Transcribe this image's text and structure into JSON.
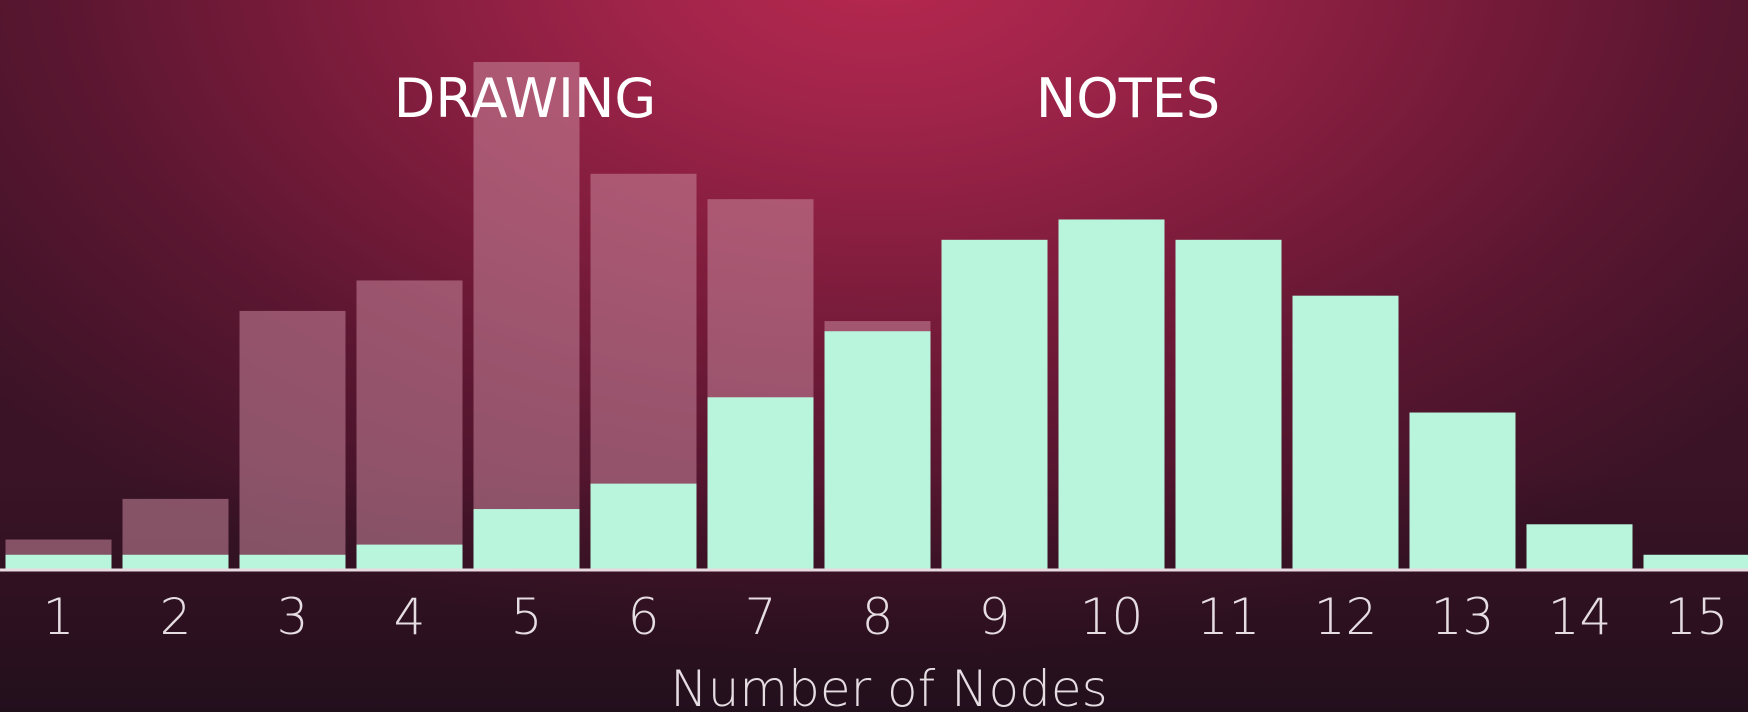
{
  "chart_data": {
    "type": "bar",
    "title": "",
    "xlabel": "Number of Nodes",
    "ylabel": "",
    "categories": [
      "1",
      "2",
      "3",
      "4",
      "5",
      "6",
      "7",
      "8",
      "9",
      "10",
      "11",
      "12",
      "13",
      "14",
      "15"
    ],
    "series": [
      {
        "name": "DRAWING",
        "color": "#c9879c",
        "values": [
          3,
          7,
          25.5,
          28.5,
          50,
          39,
          36.5,
          24.5,
          0,
          0,
          0,
          0,
          0,
          0,
          0
        ]
      },
      {
        "name": "NOTES",
        "color": "#b8f5dc",
        "values": [
          1.5,
          1.5,
          1.5,
          2.5,
          6,
          8.5,
          17,
          23.5,
          32.5,
          34.5,
          32.5,
          27,
          15.5,
          4.5,
          1.5
        ]
      }
    ],
    "ylim": [
      0,
      50
    ],
    "grid": false,
    "legend": "inline-top"
  }
}
